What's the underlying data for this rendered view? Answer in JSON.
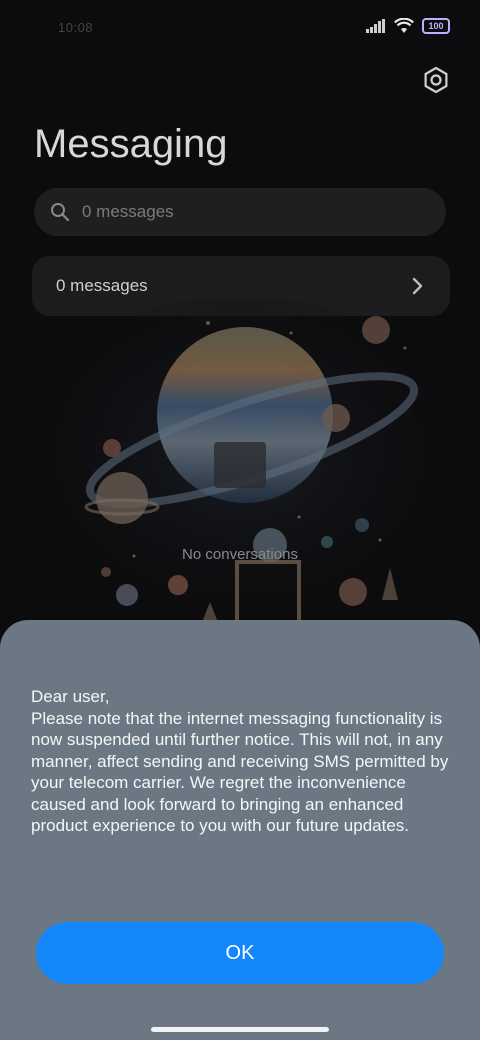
{
  "status_bar": {
    "time": "10:08",
    "signal_icon": "signal-bars-icon",
    "wifi_icon": "wifi-icon",
    "battery": "100"
  },
  "header": {
    "title": "Messaging",
    "settings_icon": "gear-icon"
  },
  "search": {
    "placeholder": "0 messages"
  },
  "messages_card": {
    "label": "0 messages"
  },
  "empty_state": {
    "text": "No conversations"
  },
  "dialog": {
    "lines": [
      "Dear user,",
      "Please note that the internet messaging functionality is now suspended until further notice. This will not, in any manner, affect sending and receiving SMS permitted by your telecom carrier. We regret the inconvenience caused and look forward to bringing an enhanced product experience to you with our future updates."
    ],
    "ok_label": "OK"
  },
  "colors": {
    "sheet_bg": "#6b7883",
    "button_blue": "#1487fa",
    "background": "#0c0c0e"
  }
}
